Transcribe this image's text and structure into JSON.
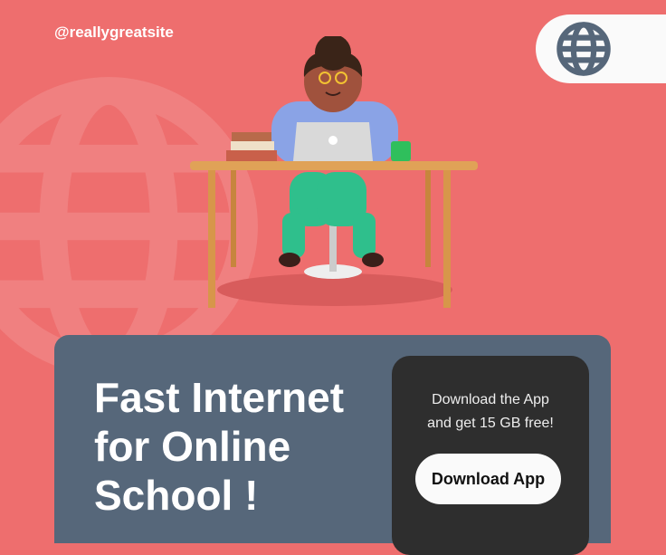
{
  "header": {
    "handle": "@reallygreatsite",
    "logo_icon": "globe-icon"
  },
  "hero": {
    "headline_lines": [
      "Fast Internet",
      "for Online",
      "School !"
    ]
  },
  "promo": {
    "lines": [
      "Download the App",
      "and get 15 GB free!"
    ],
    "button_label": "Download App"
  },
  "colors": {
    "background": "#ee6e6e",
    "panel": "#56677a",
    "card": "#2e2e2e",
    "button": "#fafafa"
  }
}
